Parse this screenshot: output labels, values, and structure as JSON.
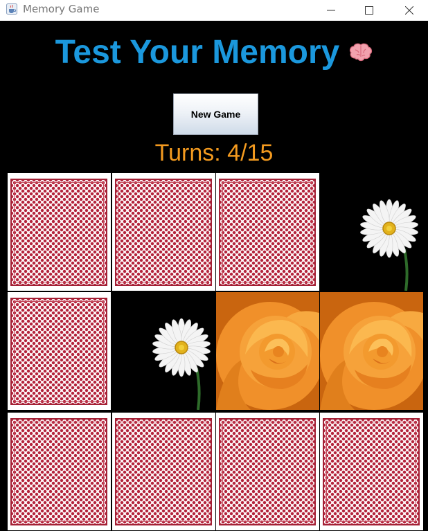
{
  "window": {
    "title": "Memory Game",
    "icon": "java-cup-icon",
    "controls": [
      "minimize-icon",
      "maximize-icon",
      "close-icon"
    ]
  },
  "header": {
    "title": "Test Your Memory",
    "emoji_icon": "brain-icon",
    "title_color": "#1b98dd"
  },
  "controls": {
    "new_game_label": "New Game"
  },
  "status": {
    "turns_text": "Turns: 4/15",
    "turns_used": 4,
    "turns_max": 15,
    "color": "#f39a1f"
  },
  "board": {
    "rows": 3,
    "cols": 4,
    "cards": [
      {
        "face": "back"
      },
      {
        "face": "back"
      },
      {
        "face": "back"
      },
      {
        "face": "daisy"
      },
      {
        "face": "back"
      },
      {
        "face": "daisy"
      },
      {
        "face": "rose"
      },
      {
        "face": "rose"
      },
      {
        "face": "back"
      },
      {
        "face": "back"
      },
      {
        "face": "back"
      },
      {
        "face": "back"
      }
    ],
    "back_color": "#a32035"
  }
}
